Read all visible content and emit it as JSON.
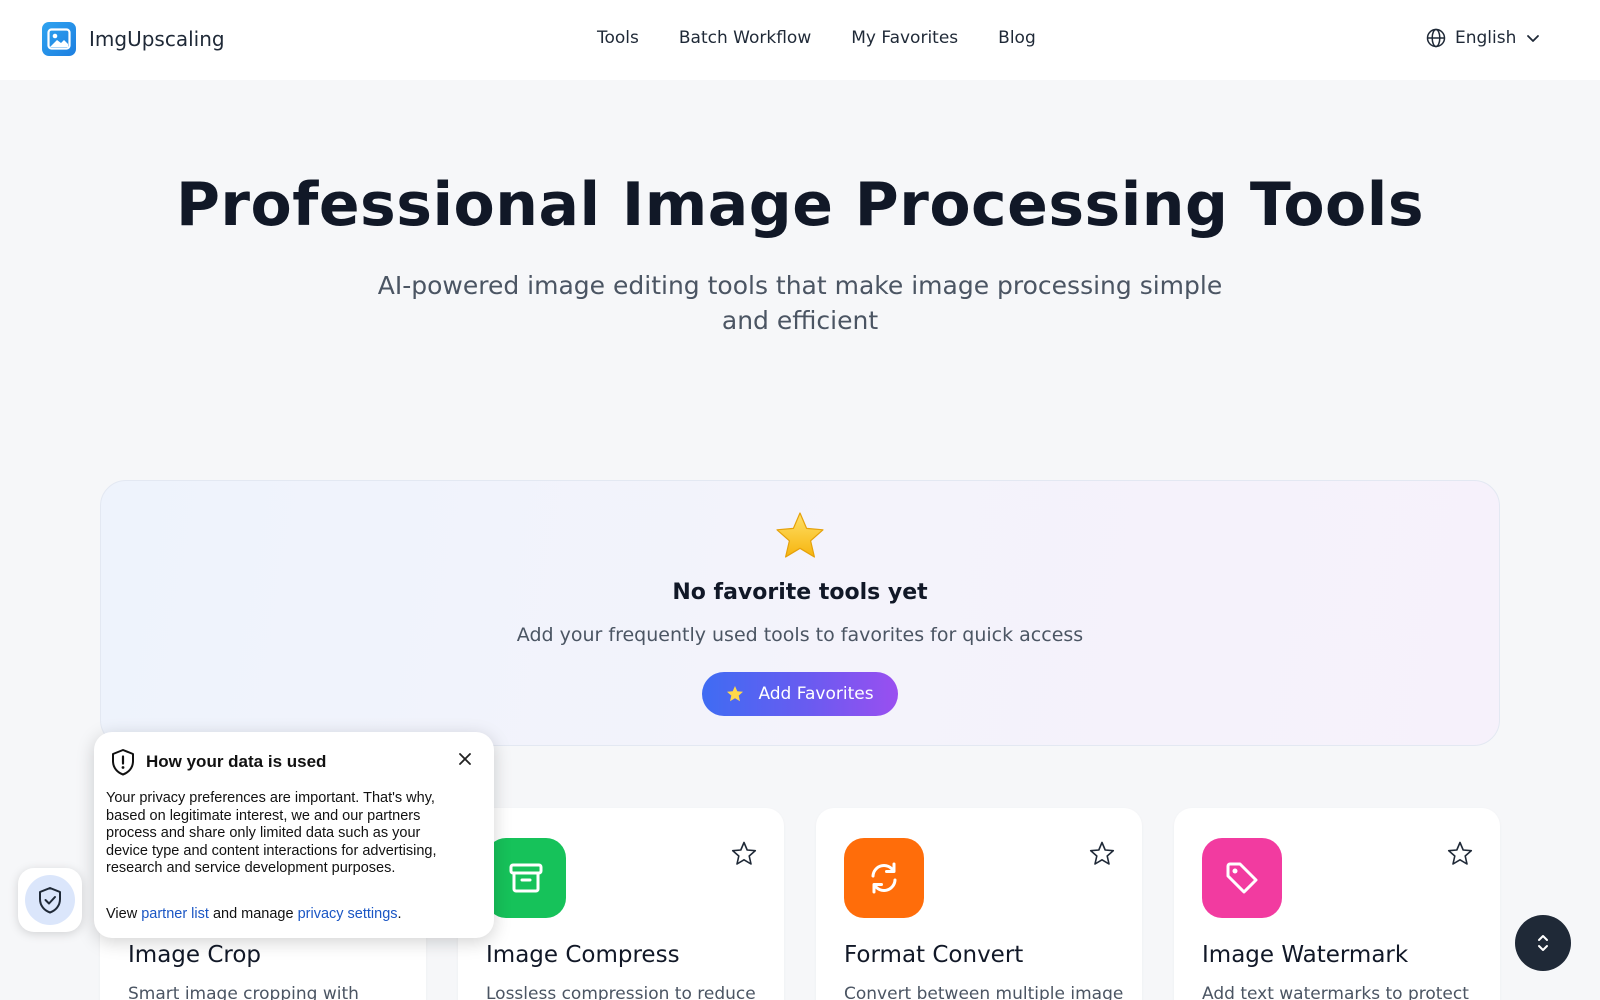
{
  "header": {
    "logo_text": "ImgUpscaling",
    "nav": [
      "Tools",
      "Batch Workflow",
      "My Favorites",
      "Blog"
    ],
    "language": "English"
  },
  "hero": {
    "title": "Professional Image Processing Tools",
    "subtitle": "AI-powered image editing tools that make image processing simple and efficient"
  },
  "favorites": {
    "title": "No favorite tools yet",
    "description": "Add your frequently used tools to favorites for quick access",
    "button_label": "Add Favorites"
  },
  "cards": [
    {
      "title": "Image Crop",
      "desc": "Smart image cropping with",
      "icon": "crop-icon",
      "color": "#2f7bf5"
    },
    {
      "title": "Image Compress",
      "desc": "Lossless compression to reduce",
      "icon": "archive-icon",
      "color": "#16c25a"
    },
    {
      "title": "Format Convert",
      "desc": "Convert between multiple image",
      "icon": "refresh-icon",
      "color": "#ff6d0a"
    },
    {
      "title": "Image Watermark",
      "desc": "Add text watermarks to protect",
      "icon": "tag-icon",
      "color": "#f23ba0"
    }
  ],
  "privacy": {
    "title": "How your data is used",
    "body": "Your privacy preferences are important. That's why, based on legitimate interest, we and our partners process and share only limited data such as your device type and content interactions for advertising, research and service development purposes.",
    "view_text": "View",
    "partner_link": "partner list",
    "manage_text": "and manage",
    "settings_link": "privacy settings",
    "period": "."
  }
}
